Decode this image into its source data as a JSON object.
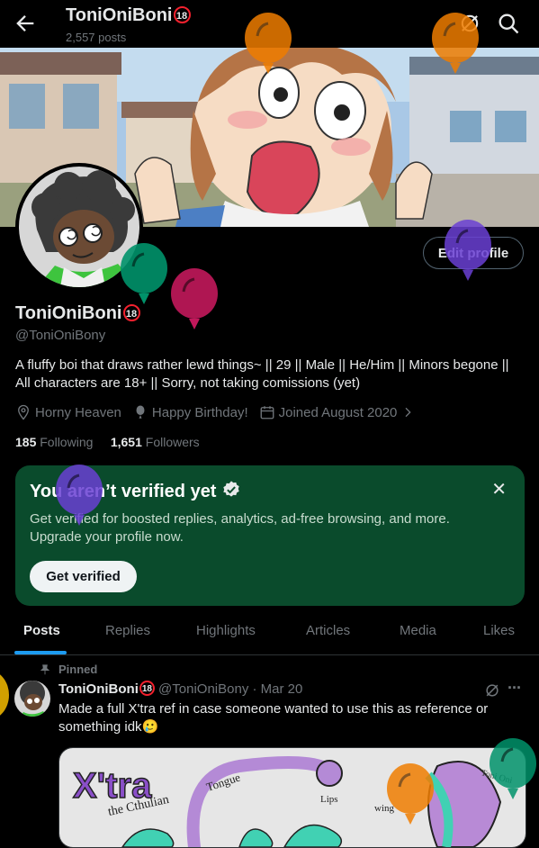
{
  "header": {
    "title": "ToniOniBoni",
    "title_badge": "18",
    "post_count": "2,557 posts"
  },
  "profile": {
    "edit_label": "Edit profile",
    "name": "ToniOniBoni",
    "name_badge": "18",
    "handle": "@ToniOniBony",
    "bio_line1": "A fluffy boi that draws rather lewd things~ || 29 || Male || He/Him || Minors begone ||",
    "bio_line2": "All characters are 18+ || Sorry, not taking comissions (yet)",
    "location": "Horny Heaven",
    "birthday": "Happy Birthday!",
    "joined": "Joined August 2020",
    "following_count": "185",
    "following_label": "Following",
    "followers_count": "1,651",
    "followers_label": "Followers"
  },
  "verify_card": {
    "title": "You aren’t verified yet",
    "desc_line1": "Get verified for boosted replies, analytics, ad-free browsing, and more.",
    "desc_line2": "Upgrade your profile now.",
    "button": "Get verified",
    "close": "✕"
  },
  "tabs": [
    "Posts",
    "Replies",
    "Highlights",
    "Articles",
    "Media",
    "Likes"
  ],
  "post": {
    "pinned_label": "Pinned",
    "author": "ToniOniBoni",
    "author_badge": "18",
    "handle_time": "@ToniOniBony · Mar 20",
    "text_line1": "Made a full X'tra ref in case someone wanted to use this as reference or",
    "text_line2": "something idk🥲",
    "more": "···",
    "image_labels": [
      "X'tra",
      "the Cthulian",
      "Tongue",
      "Lips",
      "wing",
      "Toni Oni"
    ]
  },
  "colors": {
    "accent": "#1d9bf0",
    "verify_bg": "#0a4b2c",
    "badge_red": "#f4212e",
    "balloons": [
      "#ef7d00",
      "#00926a",
      "#c2185b",
      "#6a3fd4",
      "#e8b100"
    ]
  },
  "icons": [
    "back-arrow-icon",
    "grok-icon",
    "search-icon",
    "location-icon",
    "balloon-icon",
    "calendar-icon",
    "chevron-right-icon",
    "verified-badge-icon",
    "close-icon",
    "pin-icon",
    "more-icon"
  ]
}
